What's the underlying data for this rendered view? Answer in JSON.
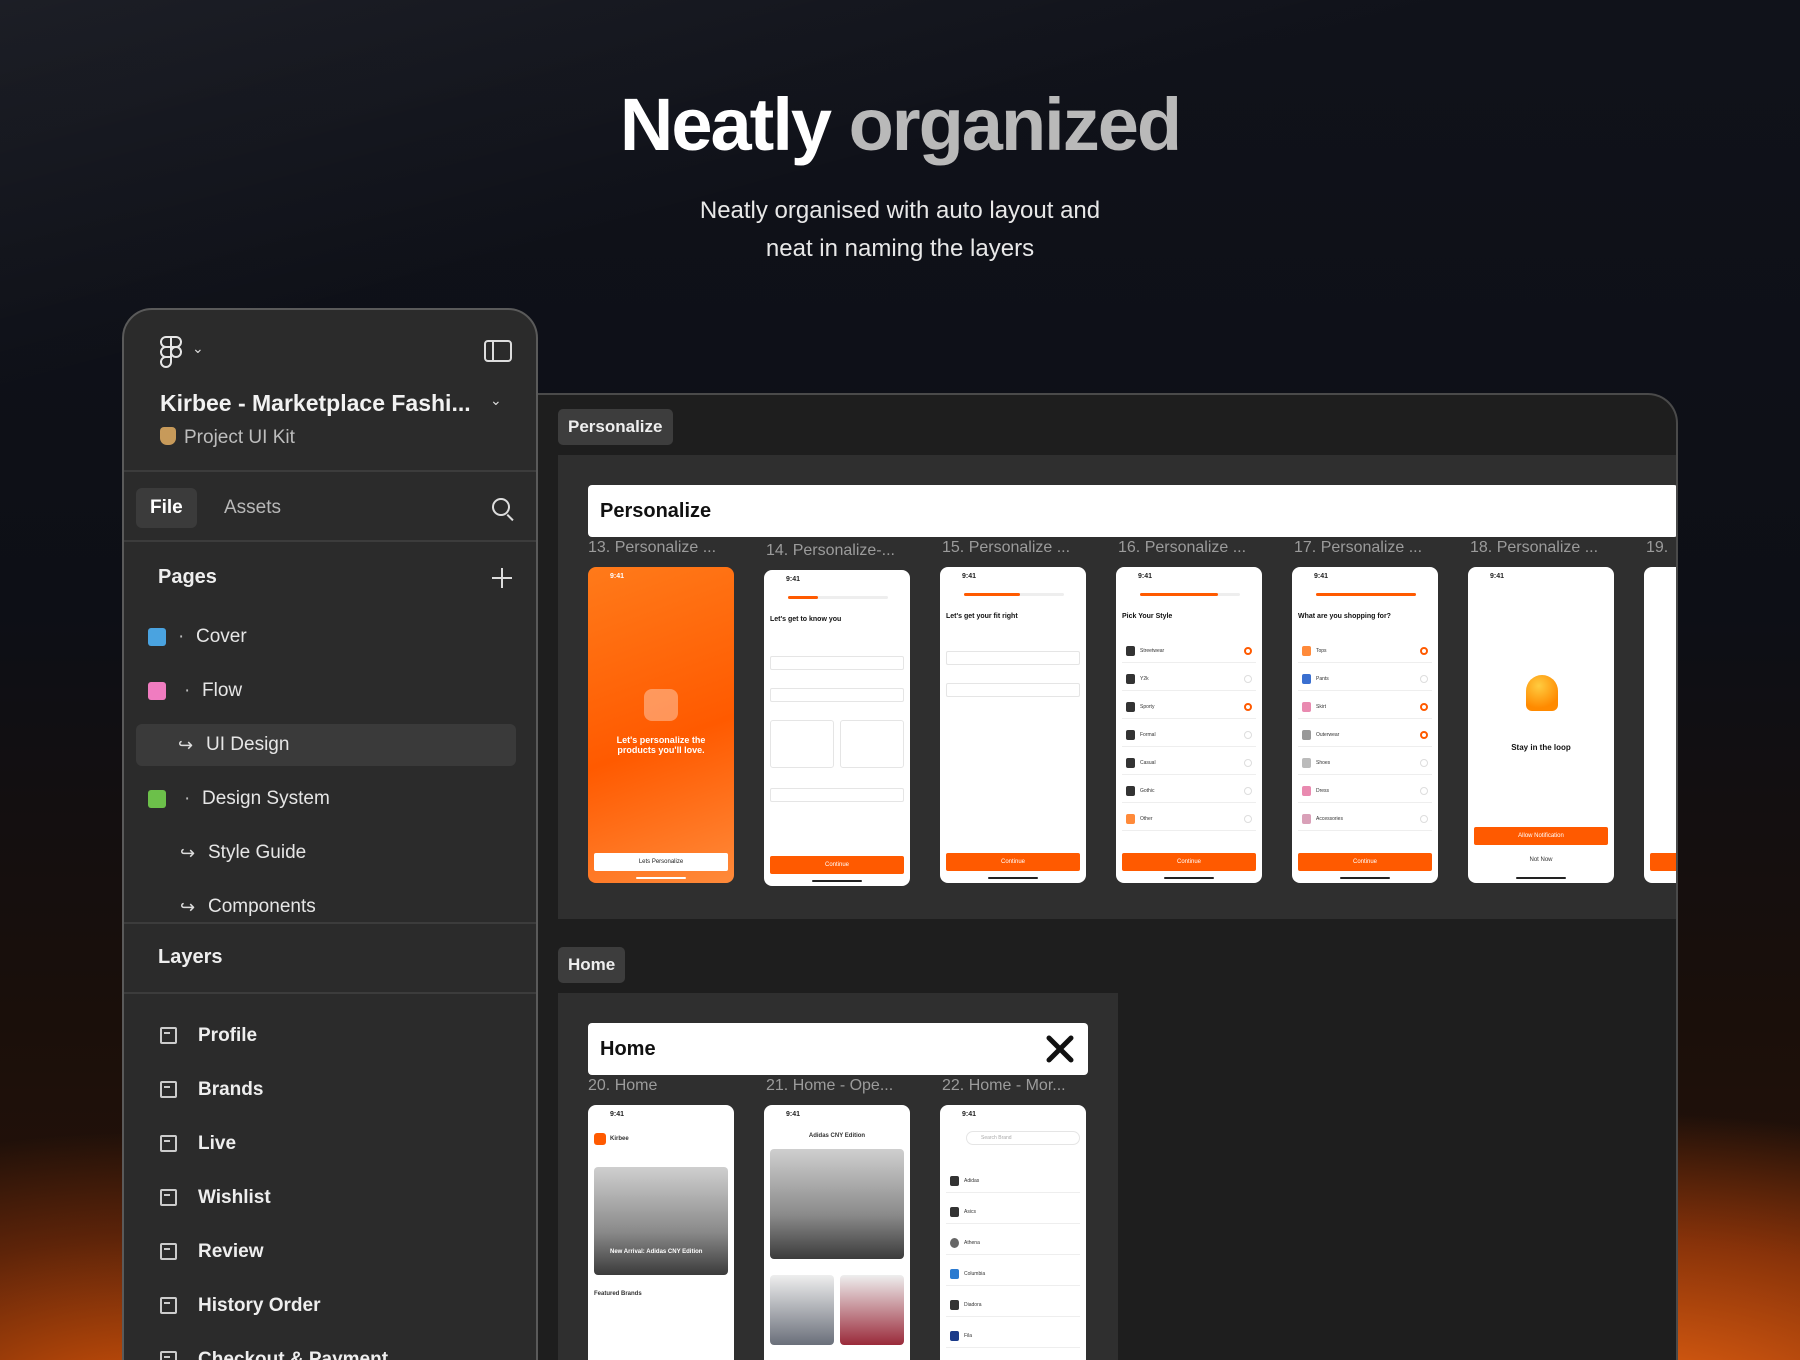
{
  "hero": {
    "title_part1": "Neatly",
    "title_part2": "organized",
    "subtitle_line1": "Neatly organised with auto layout and",
    "subtitle_line2": "neat in naming the layers"
  },
  "sidebar": {
    "file_title": "Kirbee - Marketplace Fashi...",
    "file_subtitle": "Project UI Kit",
    "tabs": {
      "file": "File",
      "assets": "Assets"
    },
    "pages_heading": "Pages",
    "pages": [
      {
        "label": "Cover",
        "type": "page"
      },
      {
        "label": "Flow",
        "type": "page"
      },
      {
        "label": "UI Design",
        "type": "subpage",
        "selected": true
      },
      {
        "label": "Design System",
        "type": "page"
      },
      {
        "label": "Style Guide",
        "type": "subpage"
      },
      {
        "label": "Components",
        "type": "subpage"
      }
    ],
    "layers_heading": "Layers",
    "layers": [
      "Profile",
      "Brands",
      "Live",
      "Wishlist",
      "Review",
      "History Order",
      "Checkout & Payment"
    ]
  },
  "canvas": {
    "sections": [
      {
        "tag": "Personalize",
        "header": "Personalize",
        "frames": [
          "13. Personalize ...",
          "14. Personalize-...",
          "15. Personalize ...",
          "16. Personalize ...",
          "17. Personalize ...",
          "18. Personalize ...",
          "19."
        ]
      },
      {
        "tag": "Home",
        "header": "Home",
        "frames": [
          "20. Home",
          "21. Home - Ope...",
          "22. Home - Mor..."
        ]
      }
    ],
    "screens": {
      "time": "9:41",
      "s13_text": "Let's personalize the products you'll love.",
      "s13_button": "Lets Personalize",
      "s14_title": "Let's get to know you",
      "s15_title": "Let's get your fit right",
      "s16_title": "Pick Your Style",
      "s16_options": [
        "Streetwear",
        "Y2k",
        "Sporty",
        "Formal",
        "Casual",
        "Gothic",
        "Other"
      ],
      "s17_title": "What are you shopping for?",
      "s17_options": [
        "Tops",
        "Pants",
        "Skirt",
        "Outerwear",
        "Shoes",
        "Dress",
        "Accessories"
      ],
      "s18_title": "Stay in the loop",
      "s18_button": "Allow Notification",
      "s18_secondary": "Not Now",
      "continue": "Continue",
      "home_brand": "Kirbee",
      "home_banner": "New Arrival: Adidas CNY Edition",
      "home_featured": "Featured Brands",
      "home21_title": "Adidas CNY Edition",
      "home22_search": "Search Brand",
      "home22_brands": [
        "Adidas",
        "Asics",
        "Athena",
        "Columbia",
        "Diadora",
        "Fila"
      ]
    }
  },
  "colors": {
    "accent": "#FF5A00",
    "panel": "#2B2B2B",
    "canvas": "#1E1E1E"
  }
}
